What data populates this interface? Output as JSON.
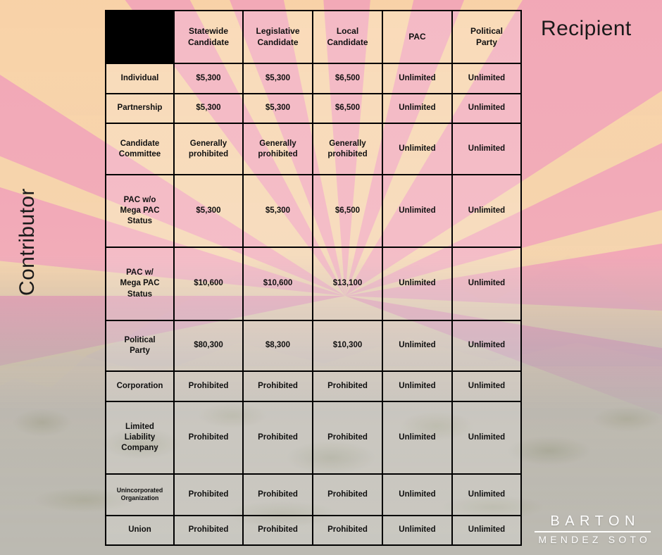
{
  "axis_labels": {
    "recipient": "Recipient",
    "contributor": "Contributor"
  },
  "table": {
    "corner_label": "",
    "column_headers": [
      "Statewide\nCandidate",
      "Legislative\nCandidate",
      "Local\nCandidate",
      "PAC",
      "Political\nParty"
    ],
    "rows": [
      {
        "label": "Individual",
        "label_size": "normal",
        "cells": [
          "$5,300",
          "$5,300",
          "$6,500",
          "Unlimited",
          "Unlimited"
        ]
      },
      {
        "label": "Partnership",
        "label_size": "normal",
        "cells": [
          "$5,300",
          "$5,300",
          "$6,500",
          "Unlimited",
          "Unlimited"
        ]
      },
      {
        "label": "Candidate\nCommittee",
        "label_size": "normal",
        "cells": [
          "Generally\nprohibited",
          "Generally\nprohibited",
          "Generally\nprohibited",
          "Unlimited",
          "Unlimited"
        ]
      },
      {
        "label": "PAC w/o\nMega PAC\nStatus",
        "label_size": "normal",
        "cells": [
          "$5,300",
          "$5,300",
          "$6,500",
          "Unlimited",
          "Unlimited"
        ]
      },
      {
        "label": "PAC w/\nMega PAC\nStatus",
        "label_size": "normal",
        "cells": [
          "$10,600",
          "$10,600",
          "$13,100",
          "Unlimited",
          "Unlimited"
        ]
      },
      {
        "label": "Political\nParty",
        "label_size": "normal",
        "cells": [
          "$80,300",
          "$8,300",
          "$10,300",
          "Unlimited",
          "Unlimited"
        ]
      },
      {
        "label": "Corporation",
        "label_size": "normal",
        "cells": [
          "Prohibited",
          "Prohibited",
          "Prohibited",
          "Unlimited",
          "Unlimited"
        ]
      },
      {
        "label": "Limited\nLiability\nCompany",
        "label_size": "normal",
        "cells": [
          "Prohibited",
          "Prohibited",
          "Prohibited",
          "Unlimited",
          "Unlimited"
        ]
      },
      {
        "label": "Unincorporated\nOrganization",
        "label_size": "small",
        "cells": [
          "Prohibited",
          "Prohibited",
          "Prohibited",
          "Unlimited",
          "Unlimited"
        ]
      },
      {
        "label": "Union",
        "label_size": "normal",
        "cells": [
          "Prohibited",
          "Prohibited",
          "Prohibited",
          "Unlimited",
          "Unlimited"
        ]
      }
    ]
  },
  "logo": {
    "top": "BARTON",
    "bottom": "MENDEZ SOTO"
  },
  "colors": {
    "ray_pink": "#f0a0b6",
    "ray_peach": "#fcd4a6",
    "corner_black": "#000000",
    "grid_line": "#000000",
    "text": "#101010",
    "logo_white": "#ffffff",
    "mountain_blue_grey": "#9fa2b3"
  }
}
